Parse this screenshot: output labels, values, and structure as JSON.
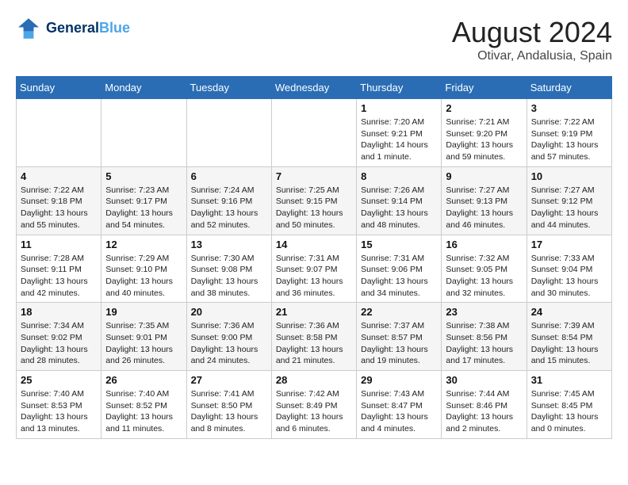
{
  "header": {
    "logo_line1": "General",
    "logo_line2": "Blue",
    "month_year": "August 2024",
    "location": "Otivar, Andalusia, Spain"
  },
  "weekdays": [
    "Sunday",
    "Monday",
    "Tuesday",
    "Wednesday",
    "Thursday",
    "Friday",
    "Saturday"
  ],
  "weeks": [
    [
      {
        "day": "",
        "info": ""
      },
      {
        "day": "",
        "info": ""
      },
      {
        "day": "",
        "info": ""
      },
      {
        "day": "",
        "info": ""
      },
      {
        "day": "1",
        "info": "Sunrise: 7:20 AM\nSunset: 9:21 PM\nDaylight: 14 hours\nand 1 minute."
      },
      {
        "day": "2",
        "info": "Sunrise: 7:21 AM\nSunset: 9:20 PM\nDaylight: 13 hours\nand 59 minutes."
      },
      {
        "day": "3",
        "info": "Sunrise: 7:22 AM\nSunset: 9:19 PM\nDaylight: 13 hours\nand 57 minutes."
      }
    ],
    [
      {
        "day": "4",
        "info": "Sunrise: 7:22 AM\nSunset: 9:18 PM\nDaylight: 13 hours\nand 55 minutes."
      },
      {
        "day": "5",
        "info": "Sunrise: 7:23 AM\nSunset: 9:17 PM\nDaylight: 13 hours\nand 54 minutes."
      },
      {
        "day": "6",
        "info": "Sunrise: 7:24 AM\nSunset: 9:16 PM\nDaylight: 13 hours\nand 52 minutes."
      },
      {
        "day": "7",
        "info": "Sunrise: 7:25 AM\nSunset: 9:15 PM\nDaylight: 13 hours\nand 50 minutes."
      },
      {
        "day": "8",
        "info": "Sunrise: 7:26 AM\nSunset: 9:14 PM\nDaylight: 13 hours\nand 48 minutes."
      },
      {
        "day": "9",
        "info": "Sunrise: 7:27 AM\nSunset: 9:13 PM\nDaylight: 13 hours\nand 46 minutes."
      },
      {
        "day": "10",
        "info": "Sunrise: 7:27 AM\nSunset: 9:12 PM\nDaylight: 13 hours\nand 44 minutes."
      }
    ],
    [
      {
        "day": "11",
        "info": "Sunrise: 7:28 AM\nSunset: 9:11 PM\nDaylight: 13 hours\nand 42 minutes."
      },
      {
        "day": "12",
        "info": "Sunrise: 7:29 AM\nSunset: 9:10 PM\nDaylight: 13 hours\nand 40 minutes."
      },
      {
        "day": "13",
        "info": "Sunrise: 7:30 AM\nSunset: 9:08 PM\nDaylight: 13 hours\nand 38 minutes."
      },
      {
        "day": "14",
        "info": "Sunrise: 7:31 AM\nSunset: 9:07 PM\nDaylight: 13 hours\nand 36 minutes."
      },
      {
        "day": "15",
        "info": "Sunrise: 7:31 AM\nSunset: 9:06 PM\nDaylight: 13 hours\nand 34 minutes."
      },
      {
        "day": "16",
        "info": "Sunrise: 7:32 AM\nSunset: 9:05 PM\nDaylight: 13 hours\nand 32 minutes."
      },
      {
        "day": "17",
        "info": "Sunrise: 7:33 AM\nSunset: 9:04 PM\nDaylight: 13 hours\nand 30 minutes."
      }
    ],
    [
      {
        "day": "18",
        "info": "Sunrise: 7:34 AM\nSunset: 9:02 PM\nDaylight: 13 hours\nand 28 minutes."
      },
      {
        "day": "19",
        "info": "Sunrise: 7:35 AM\nSunset: 9:01 PM\nDaylight: 13 hours\nand 26 minutes."
      },
      {
        "day": "20",
        "info": "Sunrise: 7:36 AM\nSunset: 9:00 PM\nDaylight: 13 hours\nand 24 minutes."
      },
      {
        "day": "21",
        "info": "Sunrise: 7:36 AM\nSunset: 8:58 PM\nDaylight: 13 hours\nand 21 minutes."
      },
      {
        "day": "22",
        "info": "Sunrise: 7:37 AM\nSunset: 8:57 PM\nDaylight: 13 hours\nand 19 minutes."
      },
      {
        "day": "23",
        "info": "Sunrise: 7:38 AM\nSunset: 8:56 PM\nDaylight: 13 hours\nand 17 minutes."
      },
      {
        "day": "24",
        "info": "Sunrise: 7:39 AM\nSunset: 8:54 PM\nDaylight: 13 hours\nand 15 minutes."
      }
    ],
    [
      {
        "day": "25",
        "info": "Sunrise: 7:40 AM\nSunset: 8:53 PM\nDaylight: 13 hours\nand 13 minutes."
      },
      {
        "day": "26",
        "info": "Sunrise: 7:40 AM\nSunset: 8:52 PM\nDaylight: 13 hours\nand 11 minutes."
      },
      {
        "day": "27",
        "info": "Sunrise: 7:41 AM\nSunset: 8:50 PM\nDaylight: 13 hours\nand 8 minutes."
      },
      {
        "day": "28",
        "info": "Sunrise: 7:42 AM\nSunset: 8:49 PM\nDaylight: 13 hours\nand 6 minutes."
      },
      {
        "day": "29",
        "info": "Sunrise: 7:43 AM\nSunset: 8:47 PM\nDaylight: 13 hours\nand 4 minutes."
      },
      {
        "day": "30",
        "info": "Sunrise: 7:44 AM\nSunset: 8:46 PM\nDaylight: 13 hours\nand 2 minutes."
      },
      {
        "day": "31",
        "info": "Sunrise: 7:45 AM\nSunset: 8:45 PM\nDaylight: 13 hours\nand 0 minutes."
      }
    ]
  ]
}
